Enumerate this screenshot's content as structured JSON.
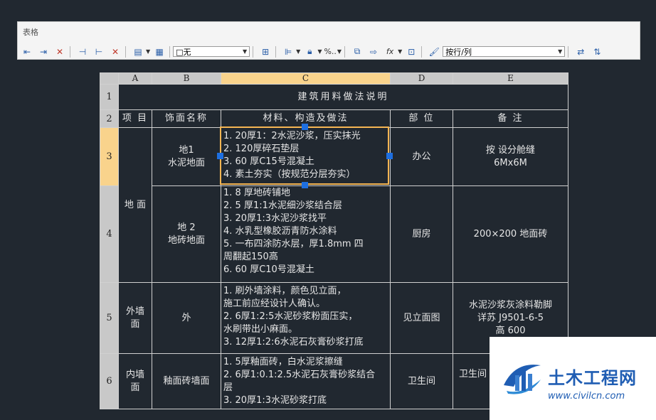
{
  "panel": {
    "title": "表格"
  },
  "toolbar": {
    "border_select": "□无",
    "text_align_select": "按行/列",
    "percent_label": "%..",
    "fx_label": "fx"
  },
  "sheet": {
    "columns": [
      "A",
      "B",
      "C",
      "D",
      "E"
    ],
    "selected_column": "C",
    "selected_row": "3",
    "rows": [
      "1",
      "2",
      "3",
      "4",
      "5",
      "6"
    ],
    "title": "建筑用料做法说明",
    "headers": {
      "project": "项  目",
      "finish_name": "饰面名称",
      "material": "材料、构造及做法",
      "location": "部  位",
      "remark": "备  注"
    },
    "r3": {
      "finish": "地1\n水泥地面",
      "material": "1. 20厚1：2水泥沙浆，压实抹光\n2. 120厚碎石垫层\n3. 60 厚C15号混凝土\n4. 素土夯实（按规范分层夯实）",
      "location": "办公",
      "remark": "按      设分舱缝\n6Mx6M"
    },
    "ground_project": "地 面",
    "r4": {
      "finish": "地  2\n地砖地面",
      "material": "1. 8 厚地砖铺地\n2. 5 厚1:1水泥细沙浆结合层\n3. 20厚1:3水泥沙浆找平\n4. 水乳型橡胶沥青防水涂料\n5. 一布四涂防水层，厚1.8mm 四\n周翻起150高\n6. 60 厚C10号混凝土",
      "location": "厨房",
      "remark": "200×200 地面砖"
    },
    "r5": {
      "project": "外墙\n面",
      "finish": "外",
      "material": "1. 刷外墙涂料，颜色见立面，\n施工前应经设计人确认。\n2. 6厚1:2:5水泥砂浆粉面压实，\n水刷带出小麻面。\n3. 12厚1:2:6水泥石灰膏砂浆打底",
      "location": "见立面图",
      "remark": "水泥沙浆灰涂料勒脚\n详苏 J9501-6-5\n高 600"
    },
    "r6": {
      "project": "内墙\n面",
      "finish": "釉面砖墙面",
      "material": "1. 5厚釉面砖，白水泥浆擦缝\n2. 6厚1:0.1:2.5水泥石灰膏砂浆结合\n层\n3. 20厚1:3水泥砂浆打底",
      "location": "卫生间",
      "remark": "卫生间"
    }
  },
  "watermark": {
    "name": "土木工程网",
    "url": "www.civilcn.com"
  },
  "colors": {
    "background": "#212830",
    "selection": "#f6b653",
    "grip": "#1e6fe0",
    "header_highlight": "#f9d38c",
    "header_gray": "#c8c8c8"
  }
}
